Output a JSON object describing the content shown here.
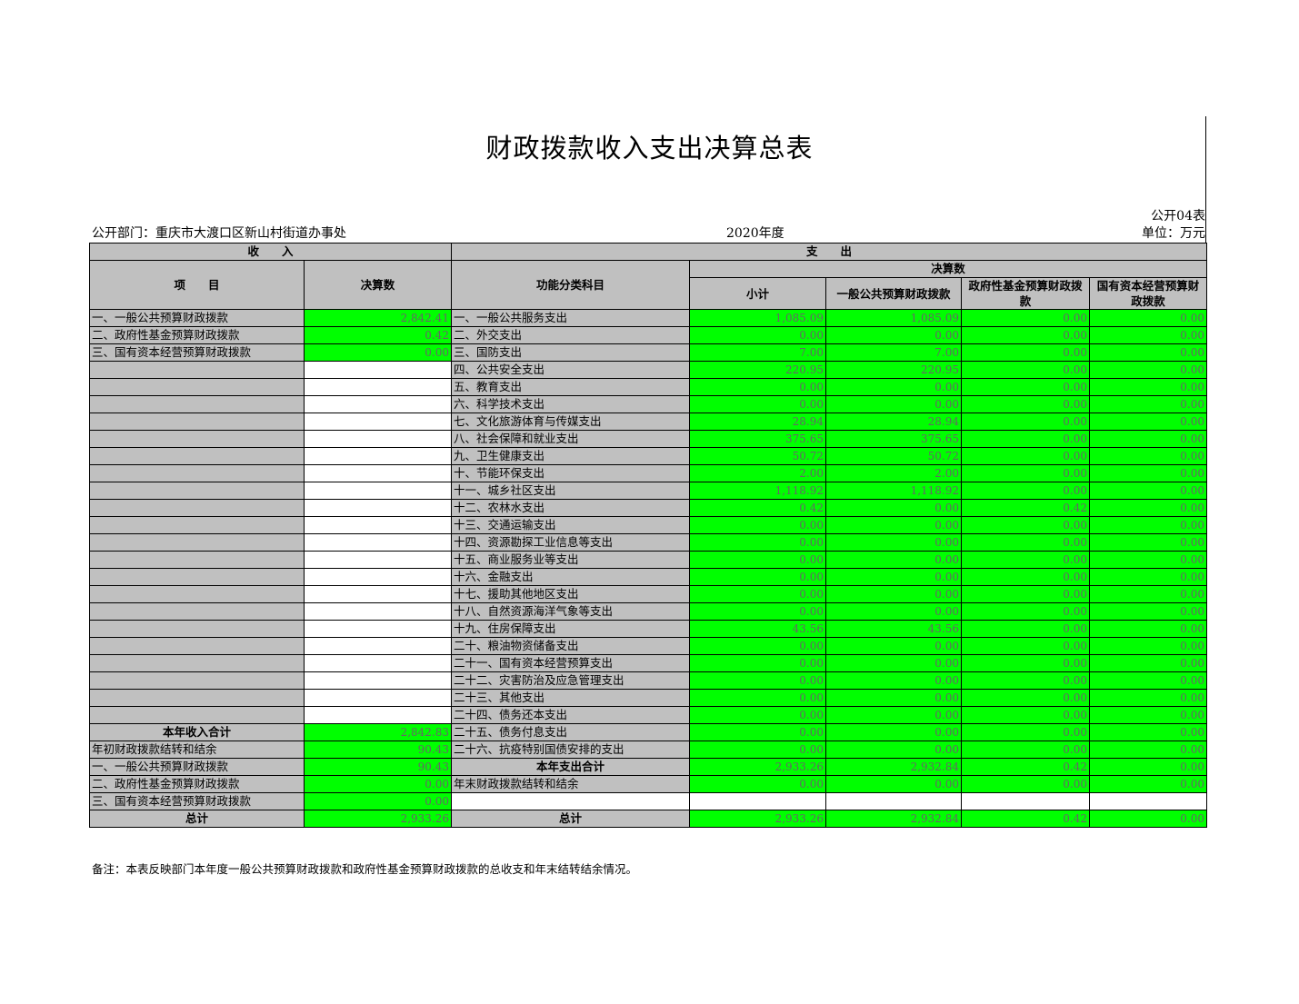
{
  "title": "财政拨款收入支出决算总表",
  "form_no": "公开04表",
  "department": "公开部门：重庆市大渡口区新山村街道办事处",
  "year": "2020年度",
  "unit": "单位：万元",
  "headers": {
    "income": "收　　入",
    "expense": "支　　出",
    "item": "项　　目",
    "amount": "决算数",
    "func_subject": "功能分类科目",
    "final_amount": "决算数",
    "subtotal": "小计",
    "general": "一般公共预算财政拨款",
    "fund": "政府性基金预算财政拨款",
    "state": "国有资本经营预算财政拨款"
  },
  "rows": [
    {
      "income_item": "一、一般公共预算财政拨款",
      "income_amt": "2,842.41",
      "exp_item": "一、一般公共服务支出",
      "vals": [
        "1,085.09",
        "1,085.09",
        "0.00",
        "0.00"
      ]
    },
    {
      "income_item": "二、政府性基金预算财政拨款",
      "income_amt": "0.42",
      "exp_item": "二、外交支出",
      "vals": [
        "0.00",
        "0.00",
        "0.00",
        "0.00"
      ]
    },
    {
      "income_item": "三、国有资本经营预算财政拨款",
      "income_amt": "0.00",
      "exp_item": "三、国防支出",
      "vals": [
        "7.00",
        "7.00",
        "0.00",
        "0.00"
      ]
    },
    {
      "income_item": "",
      "income_amt": "",
      "exp_item": "四、公共安全支出",
      "vals": [
        "220.95",
        "220.95",
        "0.00",
        "0.00"
      ]
    },
    {
      "income_item": "",
      "income_amt": "",
      "exp_item": "五、教育支出",
      "vals": [
        "0.00",
        "0.00",
        "0.00",
        "0.00"
      ]
    },
    {
      "income_item": "",
      "income_amt": "",
      "exp_item": "六、科学技术支出",
      "vals": [
        "0.00",
        "0.00",
        "0.00",
        "0.00"
      ]
    },
    {
      "income_item": "",
      "income_amt": "",
      "exp_item": "七、文化旅游体育与传媒支出",
      "vals": [
        "28.94",
        "28.94",
        "0.00",
        "0.00"
      ]
    },
    {
      "income_item": "",
      "income_amt": "",
      "exp_item": "八、社会保障和就业支出",
      "vals": [
        "375.65",
        "375.65",
        "0.00",
        "0.00"
      ]
    },
    {
      "income_item": "",
      "income_amt": "",
      "exp_item": "九、卫生健康支出",
      "vals": [
        "50.72",
        "50.72",
        "0.00",
        "0.00"
      ]
    },
    {
      "income_item": "",
      "income_amt": "",
      "exp_item": "十、节能环保支出",
      "vals": [
        "2.00",
        "2.00",
        "0.00",
        "0.00"
      ]
    },
    {
      "income_item": "",
      "income_amt": "",
      "exp_item": "十一、城乡社区支出",
      "vals": [
        "1,118.92",
        "1,118.92",
        "0.00",
        "0.00"
      ]
    },
    {
      "income_item": "",
      "income_amt": "",
      "exp_item": "十二、农林水支出",
      "vals": [
        "0.42",
        "0.00",
        "0.42",
        "0.00"
      ]
    },
    {
      "income_item": "",
      "income_amt": "",
      "exp_item": "十三、交通运输支出",
      "vals": [
        "0.00",
        "0.00",
        "0.00",
        "0.00"
      ]
    },
    {
      "income_item": "",
      "income_amt": "",
      "exp_item": "十四、资源勘探工业信息等支出",
      "vals": [
        "0.00",
        "0.00",
        "0.00",
        "0.00"
      ]
    },
    {
      "income_item": "",
      "income_amt": "",
      "exp_item": "十五、商业服务业等支出",
      "vals": [
        "0.00",
        "0.00",
        "0.00",
        "0.00"
      ]
    },
    {
      "income_item": "",
      "income_amt": "",
      "exp_item": "十六、金融支出",
      "vals": [
        "0.00",
        "0.00",
        "0.00",
        "0.00"
      ]
    },
    {
      "income_item": "",
      "income_amt": "",
      "exp_item": "十七、援助其他地区支出",
      "vals": [
        "0.00",
        "0.00",
        "0.00",
        "0.00"
      ]
    },
    {
      "income_item": "",
      "income_amt": "",
      "exp_item": "十八、自然资源海洋气象等支出",
      "vals": [
        "0.00",
        "0.00",
        "0.00",
        "0.00"
      ]
    },
    {
      "income_item": "",
      "income_amt": "",
      "exp_item": "十九、住房保障支出",
      "vals": [
        "43.56",
        "43.56",
        "0.00",
        "0.00"
      ]
    },
    {
      "income_item": "",
      "income_amt": "",
      "exp_item": "二十、粮油物资储备支出",
      "vals": [
        "0.00",
        "0.00",
        "0.00",
        "0.00"
      ]
    },
    {
      "income_item": "",
      "income_amt": "",
      "exp_item": "二十一、国有资本经营预算支出",
      "vals": [
        "0.00",
        "0.00",
        "0.00",
        "0.00"
      ]
    },
    {
      "income_item": "",
      "income_amt": "",
      "exp_item": "二十二、灾害防治及应急管理支出",
      "vals": [
        "0.00",
        "0.00",
        "0.00",
        "0.00"
      ]
    },
    {
      "income_item": "",
      "income_amt": "",
      "exp_item": "二十三、其他支出",
      "vals": [
        "0.00",
        "0.00",
        "0.00",
        "0.00"
      ]
    },
    {
      "income_item": "",
      "income_amt": "",
      "exp_item": "二十四、债务还本支出",
      "vals": [
        "0.00",
        "0.00",
        "0.00",
        "0.00"
      ]
    },
    {
      "income_item": "本年收入合计",
      "income_amt": "2,842.83",
      "exp_item": "二十五、债务付息支出",
      "vals": [
        "0.00",
        "0.00",
        "0.00",
        "0.00"
      ]
    },
    {
      "income_item": "年初财政拨款结转和结余",
      "income_amt": "90.43",
      "exp_item": "二十六、抗疫特别国债安排的支出",
      "vals": [
        "0.00",
        "0.00",
        "0.00",
        "0.00"
      ]
    },
    {
      "income_item": "一、一般公共预算财政拨款",
      "income_amt": "90.43",
      "exp_item": "本年支出合计",
      "vals": [
        "2,933.26",
        "2,932.84",
        "0.42",
        "0.00"
      ]
    },
    {
      "income_item": "二、政府性基金预算财政拨款",
      "income_amt": "0.00",
      "exp_item": "年末财政拨款结转和结余",
      "vals": [
        "0.00",
        "0.00",
        "0.00",
        "0.00"
      ]
    },
    {
      "income_item": "三、国有资本经营预算财政拨款",
      "income_amt": "0.00",
      "exp_item": "",
      "vals": [
        "",
        "",
        "",
        ""
      ]
    },
    {
      "income_item": "总计",
      "income_amt": "2,933.26",
      "exp_item": "总计",
      "vals": [
        "2,933.26",
        "2,932.84",
        "0.42",
        "0.00"
      ]
    }
  ],
  "note": "备注：本表反映部门本年度一般公共预算财政拨款和政府性基金预算财政拨款的总收支和年末结转结余情况。",
  "colors": {
    "header_gray": "#c0c0c0",
    "value_green": "#00ff00"
  }
}
